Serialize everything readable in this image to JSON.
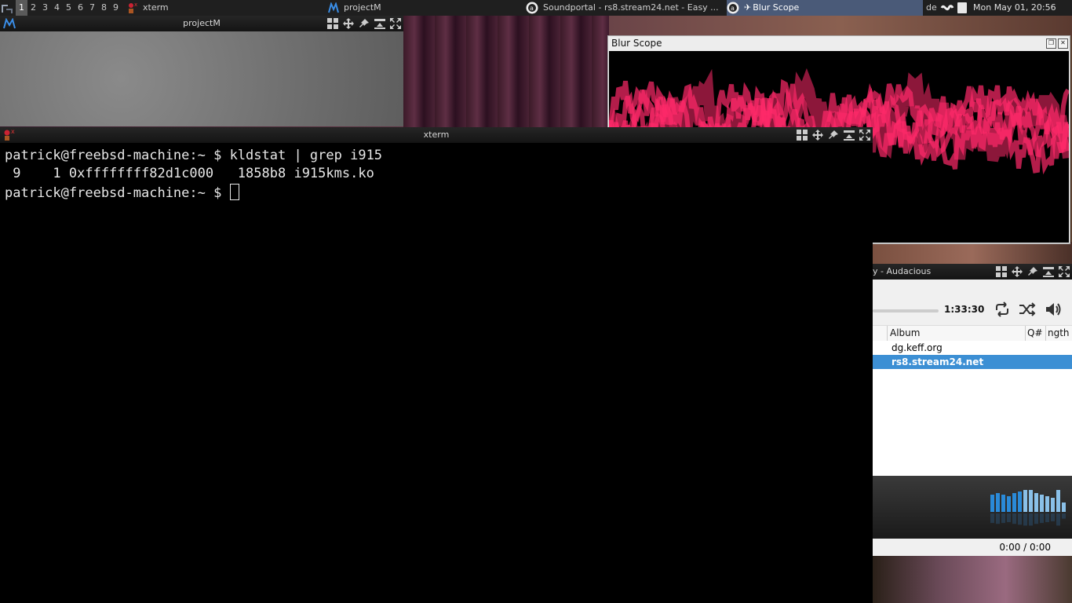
{
  "taskbar": {
    "workspaces": [
      "1",
      "2",
      "3",
      "4",
      "5",
      "6",
      "7",
      "8",
      "9"
    ],
    "active_workspace": "1",
    "tasks": [
      {
        "label": "xterm"
      },
      {
        "label": "projectM"
      },
      {
        "label": "Soundportal - rs8.stream24.net - Easy ..."
      },
      {
        "label": "Blur Scope"
      }
    ],
    "keyboard_layout": "de",
    "clock": "Mon May 01, 20:56"
  },
  "projectm": {
    "title": "projectM"
  },
  "blur_scope": {
    "title": "Blur Scope"
  },
  "xterm": {
    "title": "xterm",
    "lines": [
      "patrick@freebsd-machine:~ $ kldstat | grep i915",
      " 9    1 0xffffffff82d1c000   1858b8 i915kms.ko",
      "patrick@freebsd-machine:~ $ "
    ]
  },
  "audacious": {
    "title": "y - Audacious",
    "time": "1:33:30",
    "columns": {
      "album": "Album",
      "queue": "Q#",
      "length": "ngth"
    },
    "rows": [
      {
        "album": "dg.keff.org",
        "selected": false
      },
      {
        "album": "rs8.stream24.net",
        "selected": true
      }
    ],
    "status": "0:00 / 0:00",
    "vis_levels": [
      0.55,
      0.6,
      0.55,
      0.5,
      0.6,
      0.65,
      0.7,
      0.7,
      0.6,
      0.55,
      0.5,
      0.45,
      0.7,
      0.3
    ]
  },
  "colors": {
    "scope": "#ff2a6a",
    "selection": "#3c8fd4",
    "taskbar_active": "#4a5a78"
  }
}
